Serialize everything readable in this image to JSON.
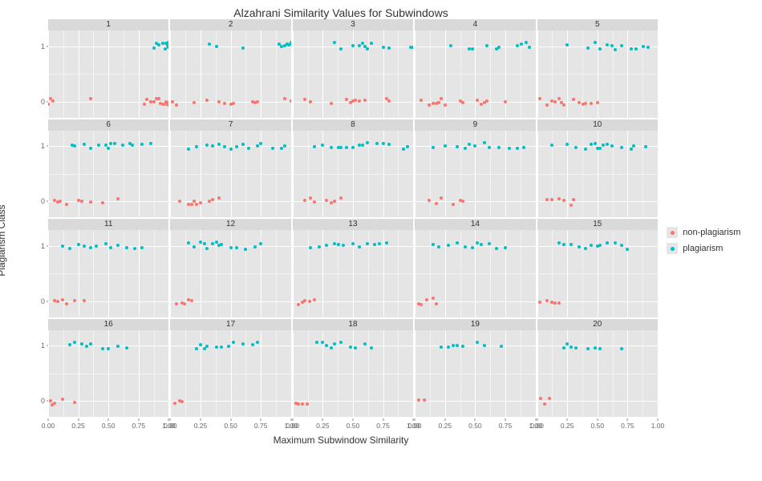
{
  "chart_data": {
    "type": "scatter",
    "title": "Alzahrani Similarity Values for Subwindows",
    "xlabel": "Maximum Subwindow Similarity",
    "ylabel": "Plagiarism Class",
    "xlim": [
      0,
      1
    ],
    "ylim": [
      0,
      1
    ],
    "x_ticks": [
      0.0,
      0.25,
      0.5,
      0.75,
      1.0
    ],
    "y_ticks": [
      0,
      1
    ],
    "legend_labels": {
      "np": "non-plagiarism",
      "pl": "plagiarism"
    },
    "colors": {
      "np": "#f8766d",
      "pl": "#00bfc4"
    },
    "facets": [
      {
        "label": "1",
        "np": [
          0.0,
          0.02,
          0.04,
          0.35,
          0.8,
          0.82,
          0.85,
          0.88,
          0.9,
          0.92,
          0.93,
          0.95,
          0.97,
          0.98,
          1.0,
          1.0,
          1.0
        ],
        "pl": [
          0.88,
          0.9,
          0.92,
          0.95,
          0.97,
          0.98,
          0.99,
          1.0,
          1.0,
          1.0,
          1.0
        ]
      },
      {
        "label": "2",
        "np": [
          0.02,
          0.05,
          0.2,
          0.3,
          0.4,
          0.45,
          0.5,
          0.52,
          0.68,
          0.7,
          0.72,
          0.95,
          1.0
        ],
        "pl": [
          0.32,
          0.38,
          0.6,
          0.9,
          0.92,
          0.95,
          0.97,
          0.98,
          1.0,
          1.0
        ]
      },
      {
        "label": "3",
        "np": [
          0.1,
          0.15,
          0.32,
          0.45,
          0.48,
          0.5,
          0.52,
          0.55,
          0.6,
          0.78,
          0.8
        ],
        "pl": [
          0.35,
          0.4,
          0.5,
          0.55,
          0.58,
          0.6,
          0.62,
          0.65,
          0.75,
          0.8,
          0.98,
          1.0,
          1.0
        ]
      },
      {
        "label": "4",
        "np": [
          0.05,
          0.12,
          0.15,
          0.18,
          0.2,
          0.22,
          0.25,
          0.38,
          0.4,
          0.52,
          0.55,
          0.58,
          0.6,
          0.75
        ],
        "pl": [
          0.3,
          0.45,
          0.48,
          0.6,
          0.68,
          0.7,
          0.85,
          0.88,
          0.92,
          0.95
        ]
      },
      {
        "label": "5",
        "np": [
          0.02,
          0.08,
          0.12,
          0.15,
          0.18,
          0.2,
          0.22,
          0.3,
          0.35,
          0.38,
          0.4,
          0.45,
          0.5
        ],
        "pl": [
          0.25,
          0.42,
          0.48,
          0.52,
          0.58,
          0.62,
          0.65,
          0.7,
          0.78,
          0.82,
          0.88,
          0.92
        ]
      },
      {
        "label": "6",
        "np": [
          0.05,
          0.08,
          0.1,
          0.15,
          0.25,
          0.28,
          0.35,
          0.45,
          0.58
        ],
        "pl": [
          0.2,
          0.22,
          0.3,
          0.35,
          0.42,
          0.48,
          0.5,
          0.52,
          0.55,
          0.62,
          0.68,
          0.7,
          0.78,
          0.85
        ]
      },
      {
        "label": "7",
        "np": [
          0.08,
          0.15,
          0.18,
          0.2,
          0.22,
          0.25,
          0.32,
          0.35,
          0.4
        ],
        "pl": [
          0.15,
          0.22,
          0.3,
          0.35,
          0.4,
          0.45,
          0.5,
          0.55,
          0.6,
          0.65,
          0.72,
          0.75,
          0.85,
          0.92,
          0.95
        ]
      },
      {
        "label": "8",
        "np": [
          0.1,
          0.15,
          0.18,
          0.28,
          0.32,
          0.35,
          0.4
        ],
        "pl": [
          0.18,
          0.25,
          0.32,
          0.38,
          0.4,
          0.45,
          0.5,
          0.55,
          0.58,
          0.62,
          0.7,
          0.75,
          0.8,
          0.92,
          0.95
        ]
      },
      {
        "label": "9",
        "np": [
          0.12,
          0.18,
          0.22,
          0.32,
          0.38,
          0.4
        ],
        "pl": [
          0.15,
          0.25,
          0.35,
          0.42,
          0.45,
          0.5,
          0.58,
          0.62,
          0.7,
          0.78,
          0.85,
          0.9
        ]
      },
      {
        "label": "10",
        "np": [
          0.08,
          0.12,
          0.18,
          0.22,
          0.28,
          0.3
        ],
        "pl": [
          0.12,
          0.25,
          0.32,
          0.4,
          0.45,
          0.48,
          0.5,
          0.52,
          0.55,
          0.58,
          0.62,
          0.7,
          0.78,
          0.8,
          0.9
        ]
      },
      {
        "label": "11",
        "np": [
          0.05,
          0.08,
          0.12,
          0.15,
          0.22,
          0.3
        ],
        "pl": [
          0.12,
          0.18,
          0.25,
          0.3,
          0.35,
          0.4,
          0.48,
          0.52,
          0.58,
          0.65,
          0.72,
          0.78
        ]
      },
      {
        "label": "12",
        "np": [
          0.05,
          0.1,
          0.12,
          0.15,
          0.18
        ],
        "pl": [
          0.15,
          0.2,
          0.25,
          0.28,
          0.3,
          0.35,
          0.38,
          0.4,
          0.42,
          0.5,
          0.55,
          0.62,
          0.7,
          0.75
        ]
      },
      {
        "label": "13",
        "np": [
          0.05,
          0.08,
          0.1,
          0.14,
          0.18
        ],
        "pl": [
          0.15,
          0.22,
          0.28,
          0.35,
          0.38,
          0.42,
          0.5,
          0.55,
          0.62,
          0.68,
          0.72,
          0.78
        ]
      },
      {
        "label": "14",
        "np": [
          0.03,
          0.05,
          0.1,
          0.15,
          0.18
        ],
        "pl": [
          0.15,
          0.2,
          0.28,
          0.35,
          0.42,
          0.48,
          0.52,
          0.55,
          0.62,
          0.68,
          0.75
        ]
      },
      {
        "label": "15",
        "np": [
          0.02,
          0.08,
          0.12,
          0.15,
          0.18
        ],
        "pl": [
          0.18,
          0.22,
          0.28,
          0.35,
          0.4,
          0.45,
          0.5,
          0.52,
          0.58,
          0.65,
          0.7,
          0.75
        ]
      },
      {
        "label": "16",
        "np": [
          0.02,
          0.03,
          0.05,
          0.12,
          0.22
        ],
        "pl": [
          0.18,
          0.22,
          0.28,
          0.32,
          0.35,
          0.45,
          0.5,
          0.58,
          0.65
        ]
      },
      {
        "label": "17",
        "np": [
          0.04,
          0.08,
          0.1
        ],
        "pl": [
          0.22,
          0.25,
          0.28,
          0.3,
          0.38,
          0.42,
          0.48,
          0.52,
          0.6,
          0.68,
          0.72
        ]
      },
      {
        "label": "18",
        "np": [
          0.03,
          0.05,
          0.08,
          0.12
        ],
        "pl": [
          0.2,
          0.25,
          0.28,
          0.32,
          0.35,
          0.4,
          0.48,
          0.52,
          0.6,
          0.65
        ]
      },
      {
        "label": "19",
        "np": [
          0.03,
          0.08
        ],
        "pl": [
          0.22,
          0.28,
          0.32,
          0.35,
          0.4,
          0.52,
          0.58,
          0.72
        ]
      },
      {
        "label": "20",
        "np": [
          0.03,
          0.06,
          0.1
        ],
        "pl": [
          0.22,
          0.25,
          0.28,
          0.32,
          0.42,
          0.48,
          0.52,
          0.7
        ]
      }
    ]
  }
}
